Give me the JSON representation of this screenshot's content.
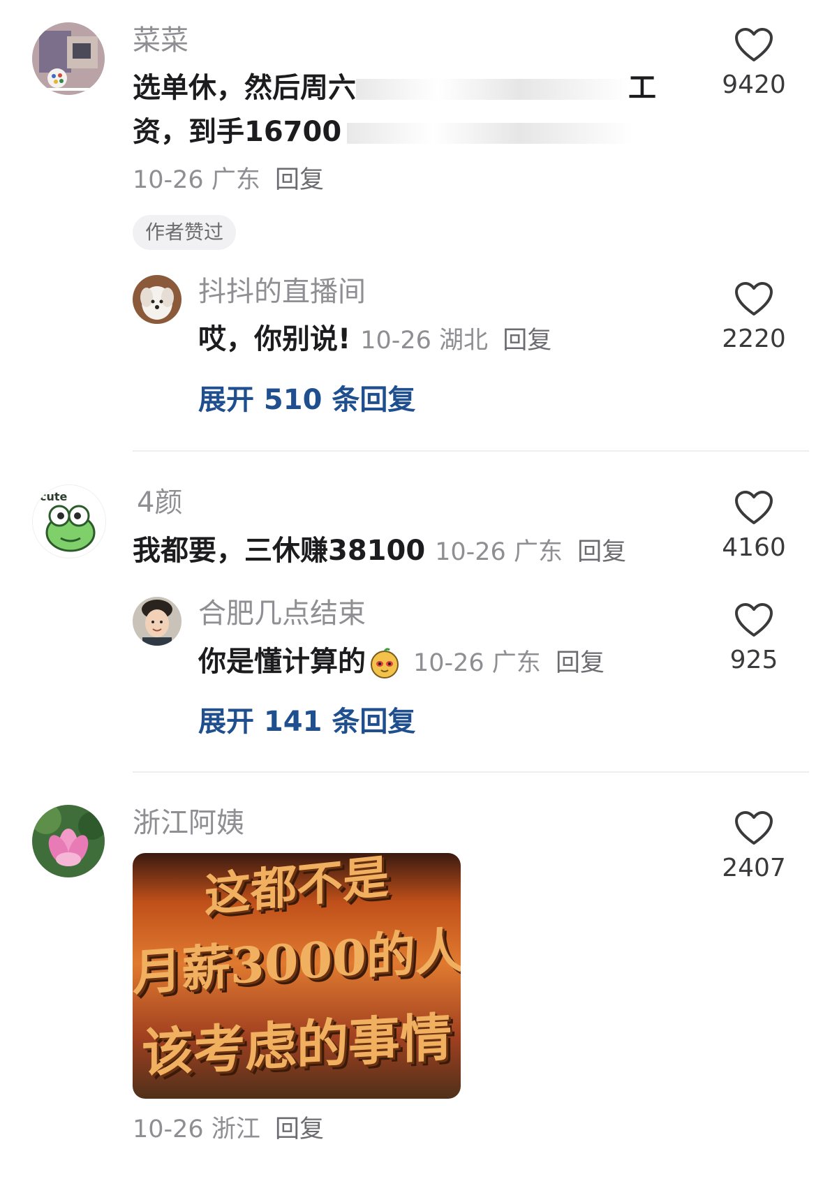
{
  "comments": [
    {
      "username": "菜菜",
      "text_line1": "选单休，然后周六",
      "text_line1_end": "工",
      "text_line2": "资，到手16700",
      "date": "10-26",
      "location": "广东",
      "reply_label": "回复",
      "likes": "9420",
      "badge": "作者赞过",
      "replies": [
        {
          "username": "抖抖的直播间",
          "text": "哎，你别说!",
          "date": "10-26",
          "location": "湖北",
          "reply_label": "回复",
          "likes": "2220"
        }
      ],
      "expand_label": "展开 510 条回复"
    },
    {
      "username": "4颜",
      "text": "我都要，三休赚38100",
      "date": "10-26",
      "location": "广东",
      "reply_label": "回复",
      "likes": "4160",
      "replies": [
        {
          "username": "合肥几点结束",
          "text": "你是懂计算的",
          "date": "10-26",
          "location": "广东",
          "reply_label": "回复",
          "likes": "925"
        }
      ],
      "expand_label": "展开 141 条回复"
    },
    {
      "username": "浙江阿姨",
      "image_text": [
        "这都不是",
        "月薪3000的人",
        "该考虑的事情"
      ],
      "date": "10-26",
      "location": "浙江",
      "reply_label": "回复",
      "likes": "2407"
    }
  ],
  "avatar_text": {
    "cute": "cute"
  },
  "colors": {
    "link": "#1f4f8f",
    "meta": "#8e8e93",
    "text": "#1c1c1e"
  }
}
